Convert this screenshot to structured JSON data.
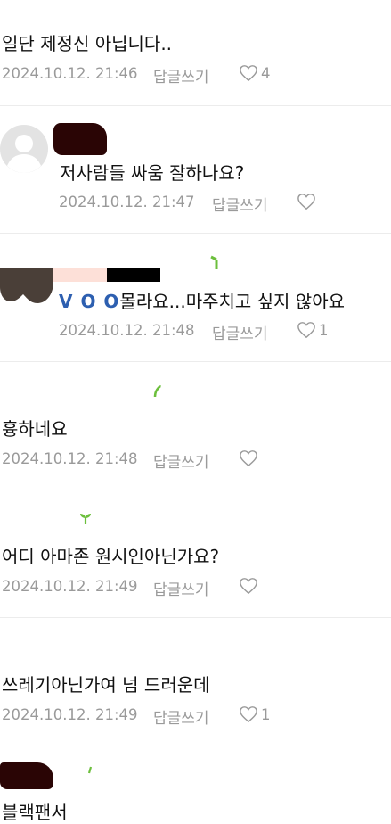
{
  "colors": {
    "text": "#111111",
    "meta": "#9a9a9a",
    "divider": "#ececec",
    "nickname_blue": "#2d5fb0",
    "sprout_green": "#6cbf3c"
  },
  "comments": [
    {
      "text": "일단 제정신 아닙니다..",
      "date": "2024.10.12. 21:46",
      "reply_label": "답글쓰기",
      "like_count": "4"
    },
    {
      "text": "저사람들 싸움 잘하나요?",
      "date": "2024.10.12. 21:47",
      "reply_label": "답글쓰기",
      "like_count": ""
    },
    {
      "mention": "V O O",
      "text": "몰라요...마주치고 싶지 않아요",
      "date": "2024.10.12. 21:48",
      "reply_label": "답글쓰기",
      "like_count": "1"
    },
    {
      "text": "흉하네요",
      "date": "2024.10.12. 21:48",
      "reply_label": "답글쓰기",
      "like_count": ""
    },
    {
      "text": "어디 아마존 원시인아닌가요?",
      "date": "2024.10.12. 21:49",
      "reply_label": "답글쓰기",
      "like_count": ""
    },
    {
      "text": "쓰레기아닌가여 넘 드러운데",
      "date": "2024.10.12. 21:49",
      "reply_label": "답글쓰기",
      "like_count": "1"
    },
    {
      "text": "블랙팬서"
    }
  ],
  "icons": {
    "like": "heart-outline-icon",
    "level": "sprout-icon",
    "avatar": "default-avatar-icon"
  }
}
